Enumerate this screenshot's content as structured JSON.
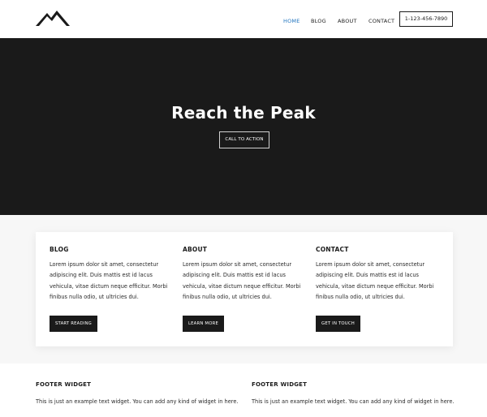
{
  "header": {
    "nav": {
      "home": "HOME",
      "blog": "BLOG",
      "about": "ABOUT",
      "contact": "CONTACT"
    },
    "phone": "1-123-456-7890",
    "active_color": "#1e73be"
  },
  "hero": {
    "title": "Reach the Peak",
    "cta": "CALL TO ACTION"
  },
  "features": {
    "columns": [
      {
        "heading": "BLOG",
        "text": "Lorem ipsum dolor sit amet, consectetur adipiscing elit. Duis mattis est id lacus vehicula, vitae dictum neque efficitur. Morbi finibus nulla odio, ut ultricies dui.",
        "button": "START READING"
      },
      {
        "heading": "ABOUT",
        "text": "Lorem ipsum dolor sit amet, consectetur adipiscing elit. Duis mattis est id lacus vehicula, vitae dictum neque efficitur. Morbi finibus nulla odio, ut ultricies dui.",
        "button": "LEARN MORE"
      },
      {
        "heading": "CONTACT",
        "text": "Lorem ipsum dolor sit amet, consectetur adipiscing elit. Duis mattis est id lacus vehicula, vitae dictum neque efficitur. Morbi finibus nulla odio, ut ultricies dui.",
        "button": "GET IN TOUCH"
      }
    ]
  },
  "footer": {
    "widgets": [
      {
        "heading": "FOOTER WIDGET",
        "text": "This is just an example text widget. You can add any kind of widget in here."
      },
      {
        "heading": "FOOTER WIDGET",
        "text": "This is just an example text widget. You can add any kind of widget in here."
      }
    ]
  }
}
